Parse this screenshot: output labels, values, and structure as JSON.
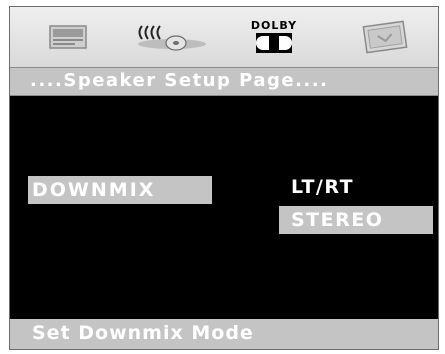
{
  "toolbar": {
    "icons": [
      {
        "name": "general-setup-icon"
      },
      {
        "name": "speaker-setup-icon"
      },
      {
        "name": "dolby-setup-icon",
        "label": "DOLBY"
      },
      {
        "name": "preference-setup-icon"
      }
    ]
  },
  "page": {
    "title": "....Speaker Setup Page...."
  },
  "menu": {
    "selected_item": "DOWNMIX",
    "options": [
      "LT/RT",
      "STEREO"
    ],
    "highlighted_option": "STEREO"
  },
  "status": {
    "text": "Set Downmix Mode"
  },
  "colors": {
    "background": "#000000",
    "highlight": "#c4c4c4",
    "text": "#ffffff"
  }
}
